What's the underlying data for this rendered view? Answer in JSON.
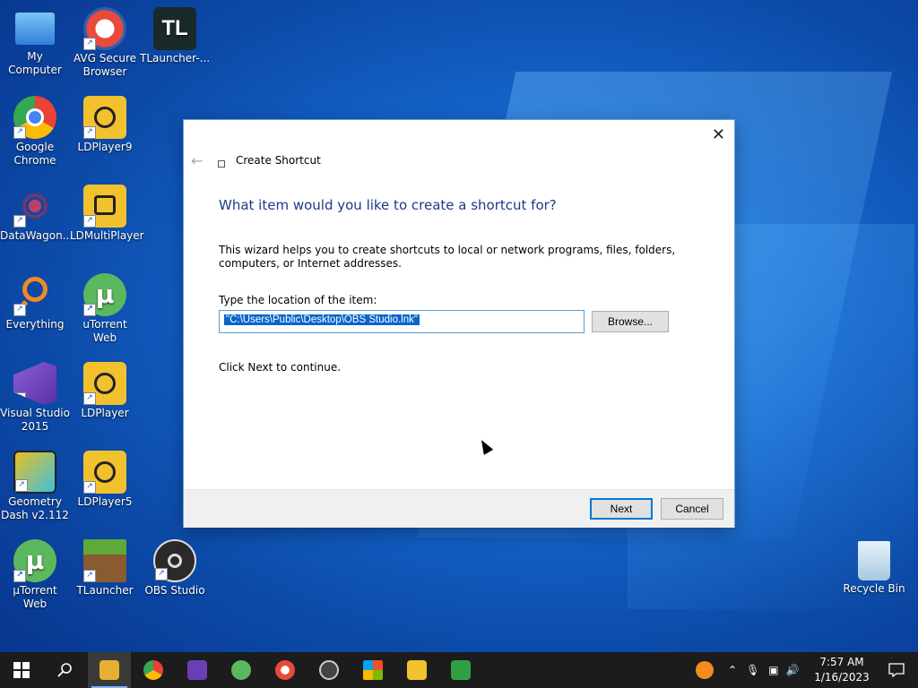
{
  "desktop": {
    "icons": [
      {
        "label": "My Computer",
        "color": "#3b8fe0",
        "icon": "computer-icon"
      },
      {
        "label": "AVG Secure Browser",
        "color": "#e84a3c",
        "icon": "avg-browser-icon"
      },
      {
        "label": "TLauncher-...",
        "color": "#1a2a2a",
        "icon": "tlauncher-icon"
      },
      {
        "label": "Google Chrome",
        "color": "#34a853",
        "icon": "chrome-icon"
      },
      {
        "label": "LDPlayer9",
        "color": "#f2c12e",
        "icon": "ldplayer-icon"
      },
      {
        "label": "DataWagon...",
        "color": "#c04060",
        "icon": "datawagon-icon"
      },
      {
        "label": "LDMultiPlayer",
        "color": "#f2c12e",
        "icon": "ldmultiplayer-icon"
      },
      {
        "label": "Everything",
        "color": "#f08a24",
        "icon": "everything-icon"
      },
      {
        "label": "uTorrent Web",
        "color": "#5cb85c",
        "icon": "utorrent-icon"
      },
      {
        "label": "Visual Studio 2015",
        "color": "#6a3fb5",
        "icon": "visual-studio-icon"
      },
      {
        "label": "LDPlayer",
        "color": "#f2c12e",
        "icon": "ldplayer-icon"
      },
      {
        "label": "Geometry Dash v2.112",
        "color": "#e8c020",
        "icon": "geometry-dash-icon"
      },
      {
        "label": "LDPlayer5",
        "color": "#f2c12e",
        "icon": "ldplayer-icon"
      },
      {
        "label": "µTorrent Web",
        "color": "#5cb85c",
        "icon": "utorrent-icon"
      },
      {
        "label": "TLauncher",
        "color": "#5a8a3a",
        "icon": "minecraft-icon"
      },
      {
        "label": "OBS Studio",
        "color": "#2a2a2a",
        "icon": "obs-icon"
      },
      {
        "label": "Recycle Bin",
        "color": "#c8e0f0",
        "icon": "recycle-bin-icon"
      }
    ]
  },
  "dialog": {
    "title": "Create Shortcut",
    "heading": "What item would you like to create a shortcut for?",
    "description": "This wizard helps you to create shortcuts to local or network programs, files, folders, computers, or Internet addresses.",
    "location_label": "Type the location of the item:",
    "location_value": "\"C:\\Users\\Public\\Desktop\\OBS Studio.lnk\"",
    "browse_label": "Browse...",
    "continue_text": "Click Next to continue.",
    "next_label": "Next",
    "cancel_label": "Cancel",
    "close_glyph": "✕",
    "back_glyph": "←"
  },
  "taskbar": {
    "apps": [
      {
        "name": "file-explorer-icon",
        "color": "#e8b030",
        "active": true
      },
      {
        "name": "chrome-icon",
        "color": "#34a853"
      },
      {
        "name": "visual-studio-icon",
        "color": "#6a3fb5"
      },
      {
        "name": "utorrent-icon",
        "color": "#5cb85c"
      },
      {
        "name": "avg-browser-icon",
        "color": "#e84a3c"
      },
      {
        "name": "obs-icon",
        "color": "#444444"
      },
      {
        "name": "microsoft-store-icon",
        "color": "#2a8ae8"
      },
      {
        "name": "ldplayer-icon",
        "color": "#f2c12e"
      },
      {
        "name": "xbox-icon",
        "color": "#2ea043"
      }
    ],
    "clock": {
      "time": "7:57 AM",
      "date": "1/16/2023"
    }
  }
}
